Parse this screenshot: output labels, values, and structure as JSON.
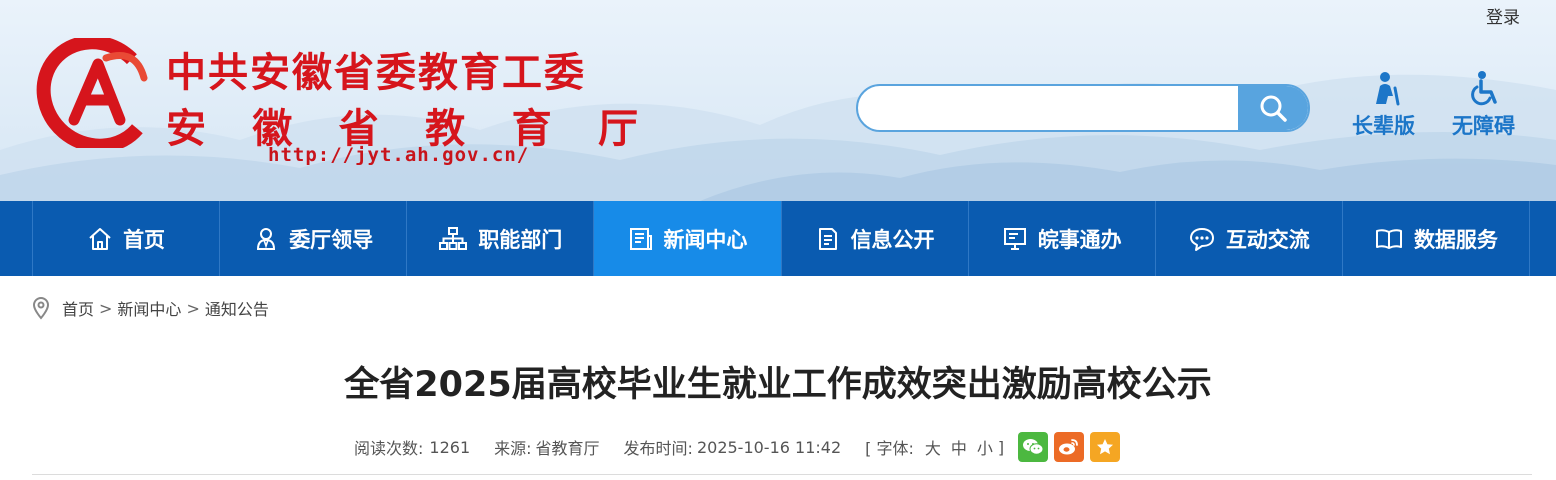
{
  "header": {
    "login_label": "登录",
    "org_name_line1": "中共安徽省委教育工委",
    "org_name_line2_chars": [
      "安",
      "徽",
      "省",
      "教",
      "育",
      "厅"
    ],
    "site_url": "http://jyt.ah.gov.cn/",
    "search": {
      "placeholder": "",
      "value": ""
    },
    "elder_mode_label": "长辈版",
    "accessibility_label": "无障碍",
    "brand_color": "#d6151c",
    "accent_color": "#1c76c8"
  },
  "nav": {
    "items": [
      {
        "label": "首页",
        "icon": "home-icon"
      },
      {
        "label": "委厅领导",
        "icon": "leaders-icon"
      },
      {
        "label": "职能部门",
        "icon": "org-chart-icon"
      },
      {
        "label": "新闻中心",
        "icon": "news-icon",
        "active": true
      },
      {
        "label": "信息公开",
        "icon": "document-icon"
      },
      {
        "label": "皖事通办",
        "icon": "monitor-icon"
      },
      {
        "label": "互动交流",
        "icon": "chat-icon"
      },
      {
        "label": "数据服务",
        "icon": "book-icon"
      }
    ],
    "bg_color": "#0a5bb0",
    "active_color": "#178be8"
  },
  "breadcrumb": {
    "items": [
      "首页",
      "新闻中心",
      "通知公告"
    ],
    "separator": ">"
  },
  "article": {
    "title": "全省2025届高校毕业生就业工作成效突出激励高校公示",
    "views_label": "阅读次数:",
    "views": "1261",
    "source_label": "来源:",
    "source": "省教育厅",
    "published_label": "发布时间:",
    "published": "2025-10-16 11:42",
    "font_open": "[ 字体:",
    "font_large": "大",
    "font_medium": "中",
    "font_small": "小",
    "font_close": "]",
    "share": [
      "wechat-icon",
      "weibo-icon",
      "favorite-icon"
    ]
  }
}
